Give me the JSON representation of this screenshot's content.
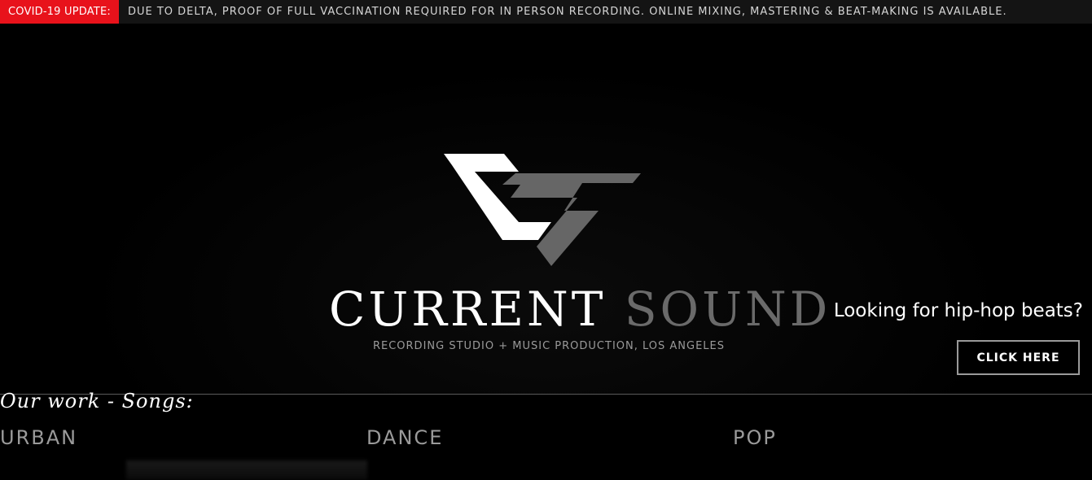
{
  "announcement": {
    "tag": "COVID-19 UPDATE:",
    "message": "DUE TO DELTA, PROOF OF FULL VACCINATION REQUIRED FOR IN PERSON RECORDING. ONLINE MIXING, MASTERING & BEAT-MAKING IS AVAILABLE.",
    "tag_color": "#e8121b"
  },
  "brand": {
    "word1": "CURRENT",
    "word2": "SOUND",
    "tagline": "RECORDING STUDIO + MUSIC PRODUCTION, LOS ANGELES",
    "logo_icon": "cs-monogram-icon",
    "primary_color": "#ffffff",
    "secondary_color": "#6a6a6a"
  },
  "promo": {
    "text": "Looking for hip-hop beats?",
    "button_label": "CLICK HERE"
  },
  "work": {
    "title": "Our work - Songs:",
    "genres": [
      "URBAN",
      "DANCE",
      "POP"
    ]
  }
}
